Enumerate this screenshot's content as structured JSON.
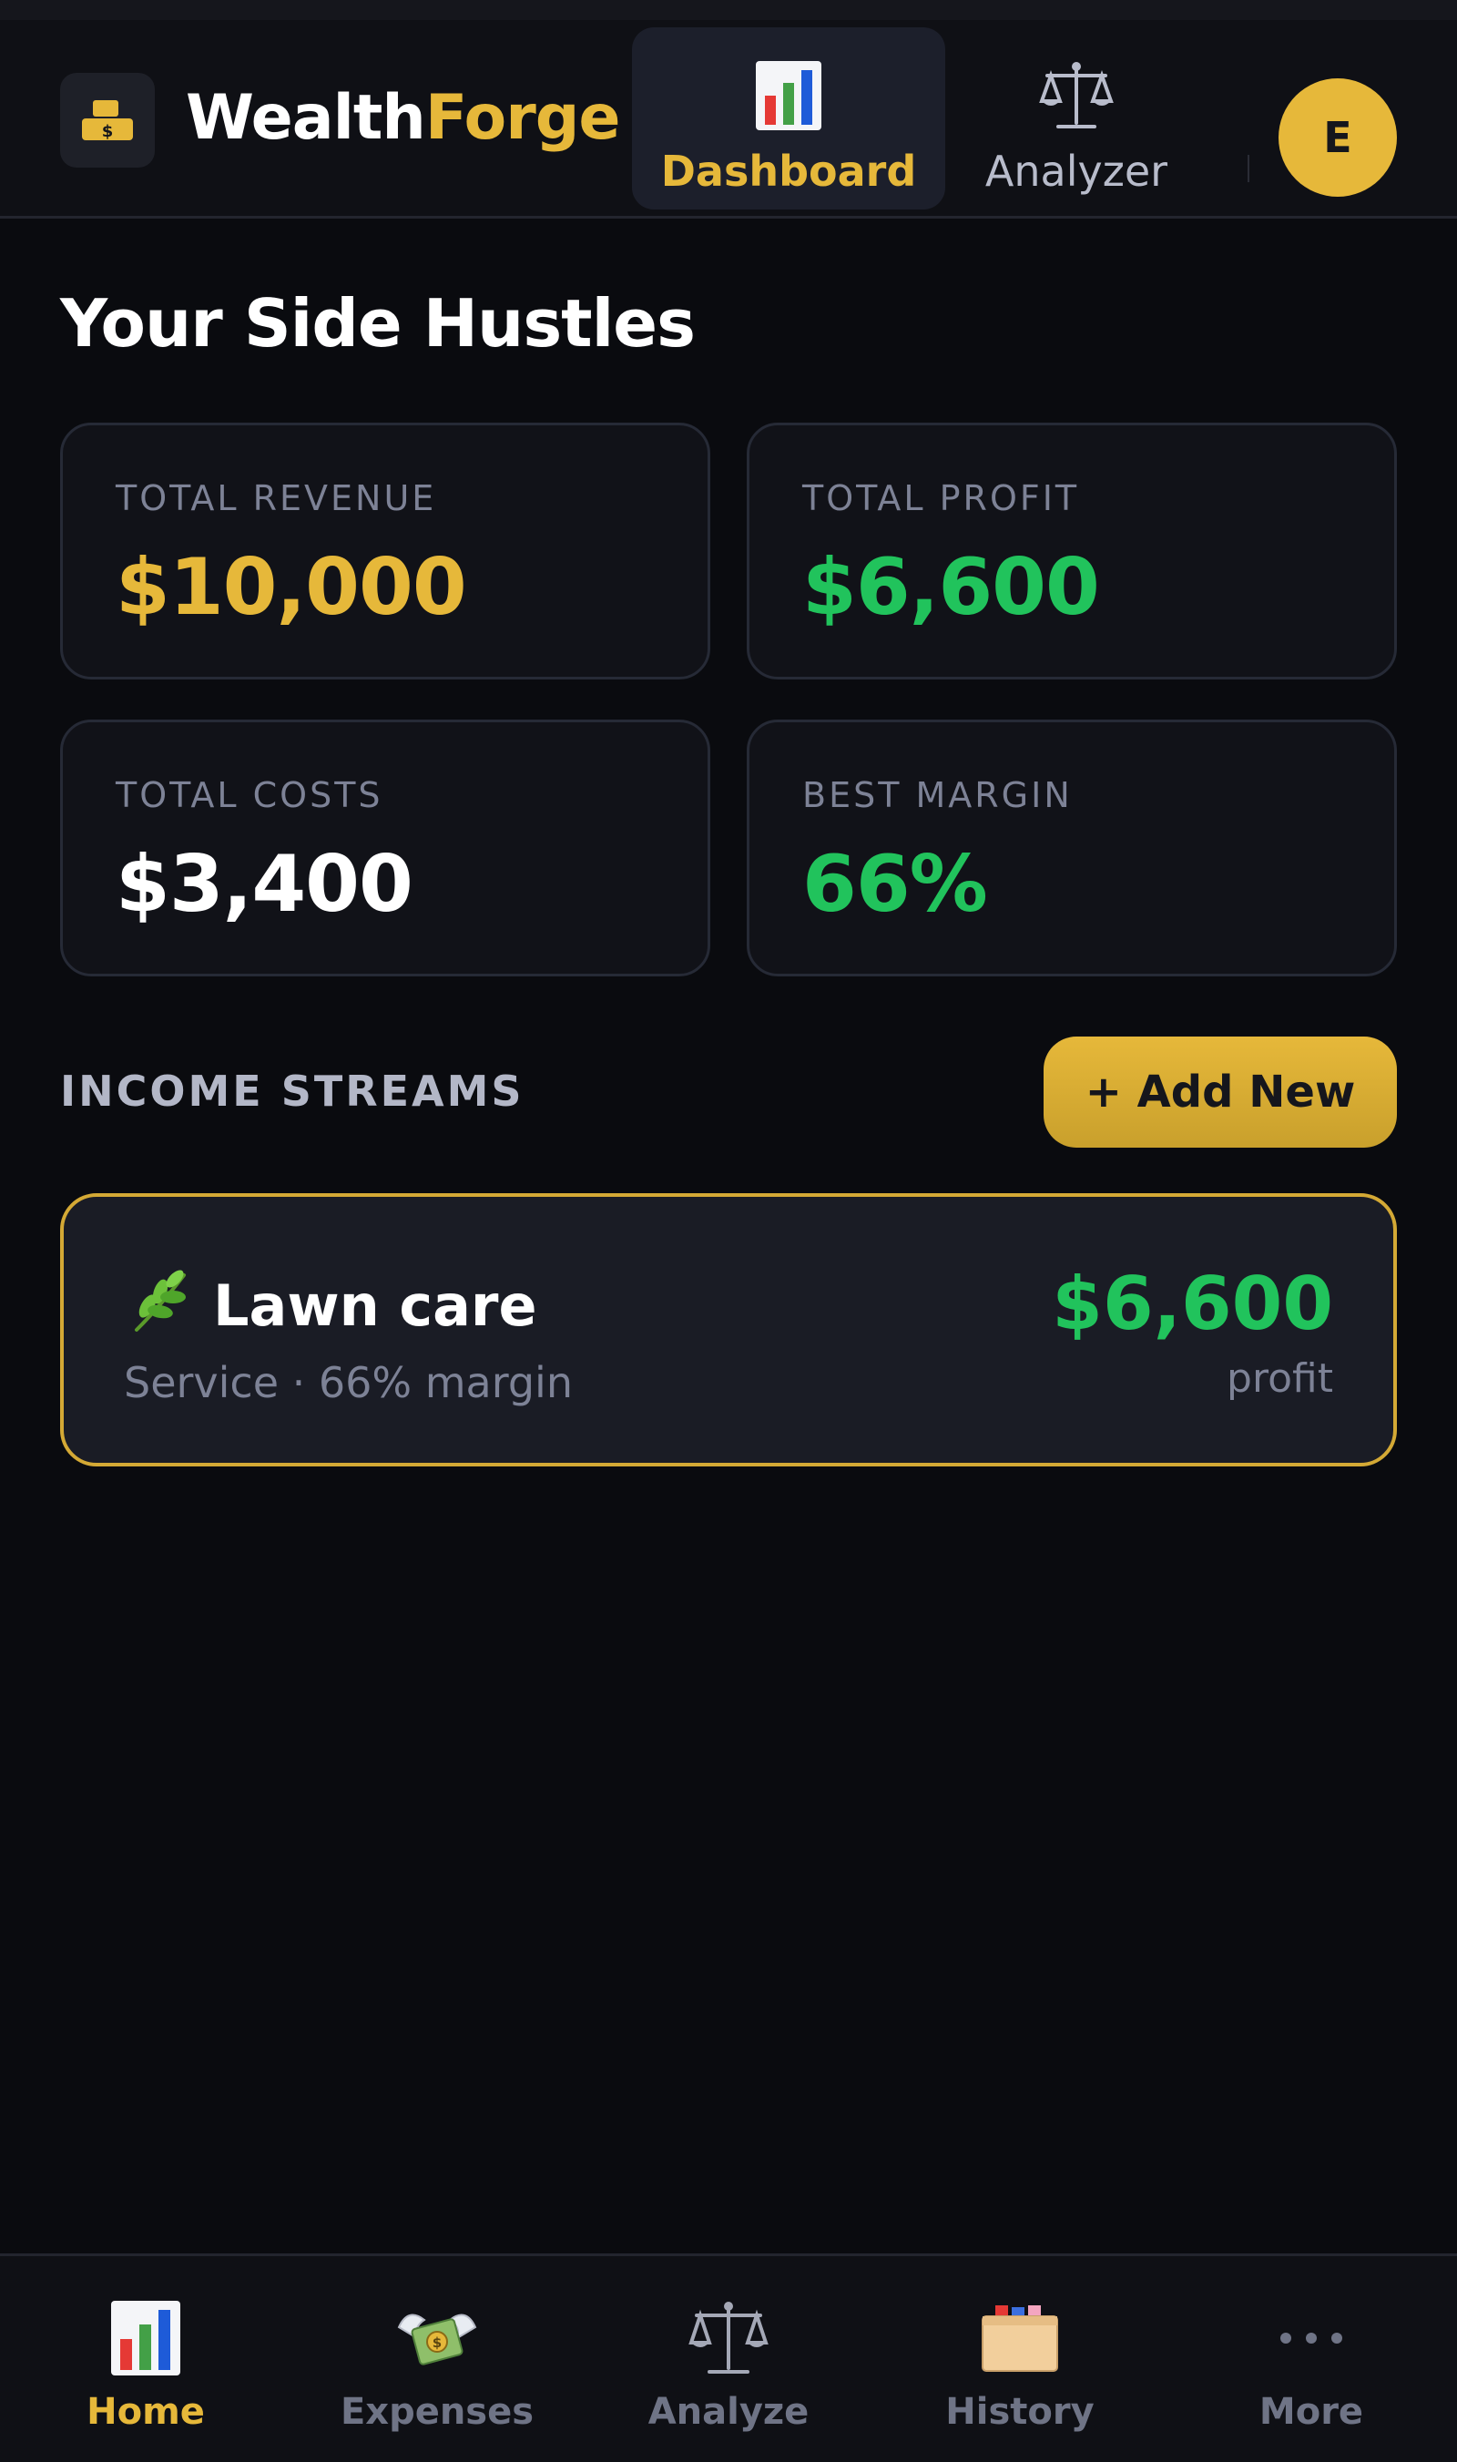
{
  "app": {
    "brand_primary": "Wealth",
    "brand_accent": "Forge",
    "accent_color": "#e6b83a",
    "profit_color": "#21c35c",
    "logo_icon": "gold-bars-icon"
  },
  "header": {
    "tabs": [
      {
        "label": "Dashboard",
        "icon": "bar-chart-icon",
        "active": true
      },
      {
        "label": "Analyzer",
        "icon": "balance-scale-icon",
        "active": false
      }
    ],
    "avatar_initial": "E"
  },
  "main": {
    "title": "Your Side Hustles",
    "stats": [
      {
        "label": "TOTAL REVENUE",
        "value": "$10,000",
        "color": "#e6b83a"
      },
      {
        "label": "TOTAL PROFIT",
        "value": "$6,600",
        "color": "#21c35c"
      },
      {
        "label": "TOTAL COSTS",
        "value": "$3,400",
        "color": "#ffffff"
      },
      {
        "label": "BEST MARGIN",
        "value": "66%",
        "color": "#21c35c"
      }
    ],
    "section_heading": "INCOME STREAMS",
    "add_button_label": "+ Add New",
    "streams": [
      {
        "icon": "herb-icon",
        "name": "Lawn care",
        "meta": "Service · 66% margin",
        "profit": "$6,600",
        "profit_label": "profit"
      }
    ]
  },
  "bottom_nav": {
    "items": [
      {
        "label": "Home",
        "icon": "bar-chart-icon",
        "active": true
      },
      {
        "label": "Expenses",
        "icon": "money-wings-icon",
        "active": false
      },
      {
        "label": "Analyze",
        "icon": "balance-scale-icon",
        "active": false
      },
      {
        "label": "History",
        "icon": "card-file-box-icon",
        "active": false
      },
      {
        "label": "More",
        "icon": "more-dots-icon",
        "active": false
      }
    ]
  }
}
